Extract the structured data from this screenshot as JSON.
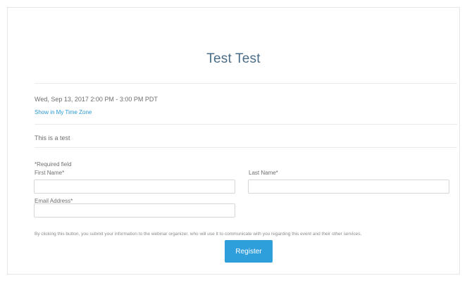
{
  "event": {
    "title": "Test Test",
    "datetime": "Wed, Sep 13, 2017 2:00 PM - 3:00 PM PDT",
    "timezone_link": "Show in My Time Zone",
    "description": "This is a test"
  },
  "form": {
    "required_note": "*Required field",
    "first_name_label": "First Name*",
    "first_name_value": "",
    "last_name_label": "Last Name*",
    "last_name_value": "",
    "email_label": "Email Address*",
    "email_value": "",
    "consent_text": "By clicking this button, you submit your information to the webinar organizer, who will use it to communicate with you regarding this event and their other services.",
    "register_label": "Register"
  },
  "colors": {
    "title": "#4a6d87",
    "link": "#2a9ad6",
    "button": "#2f9fdc"
  }
}
